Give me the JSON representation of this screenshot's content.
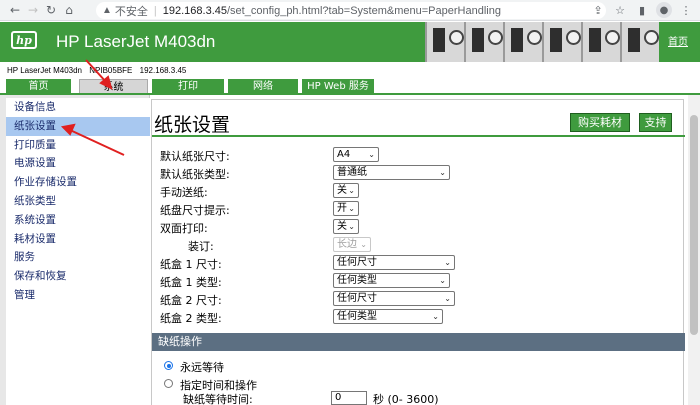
{
  "browser": {
    "insecure_label": "不安全",
    "url_host": "192.168.3.45",
    "url_path": "/set_config_ph.html?tab=System&menu=PaperHandling"
  },
  "header": {
    "logo_text": "hp",
    "product": "HP LaserJet M403dn",
    "home_link": "首页",
    "device_model": "HP LaserJet M403dn",
    "device_name": "NPIB05BFE",
    "device_ip": "192.168.3.45"
  },
  "tabs": [
    {
      "label": "首页",
      "active": false
    },
    {
      "label": "系统",
      "active": true
    },
    {
      "label": "打印",
      "active": false
    },
    {
      "label": "网络",
      "active": false
    },
    {
      "label": "HP Web 服务",
      "active": false
    }
  ],
  "sidebar": {
    "items": [
      {
        "label": "设备信息",
        "active": false
      },
      {
        "label": "纸张设置",
        "active": true
      },
      {
        "label": "打印质量",
        "active": false
      },
      {
        "label": "电源设置",
        "active": false
      },
      {
        "label": "作业存储设置",
        "active": false
      },
      {
        "label": "纸张类型",
        "active": false
      },
      {
        "label": "系统设置",
        "active": false
      },
      {
        "label": "耗材设置",
        "active": false
      },
      {
        "label": "服务",
        "active": false
      },
      {
        "label": "保存和恢复",
        "active": false
      },
      {
        "label": "管理",
        "active": false
      }
    ]
  },
  "main": {
    "title": "纸张设置",
    "buy_supplies": "购买耗材",
    "support": "支持",
    "fields": [
      {
        "label": "默认纸张尺寸:",
        "value": "A4"
      },
      {
        "label": "默认纸张类型:",
        "value": "普通纸"
      },
      {
        "label": "手动送纸:",
        "value": "关"
      },
      {
        "label": "纸盘尺寸提示:",
        "value": "开"
      },
      {
        "label": "双面打印:",
        "value": "关"
      },
      {
        "label": "装订:",
        "value": "长边"
      },
      {
        "label": "纸盒 1 尺寸:",
        "value": "任何尺寸"
      },
      {
        "label": "纸盒 1 类型:",
        "value": "任何类型"
      },
      {
        "label": "纸盒 2 尺寸:",
        "value": "任何尺寸"
      },
      {
        "label": "纸盒 2 类型:",
        "value": "任何类型"
      }
    ],
    "section_title": "缺纸操作",
    "radio_wait_forever": "永远等待",
    "radio_timed": "指定时间和操作",
    "wait_label": "缺纸等待时间:",
    "wait_value": "0",
    "wait_unit": "秒 (0- 3600)"
  },
  "colors": {
    "hp_green": "#3f9b3e",
    "annotation_red": "#e02020"
  }
}
